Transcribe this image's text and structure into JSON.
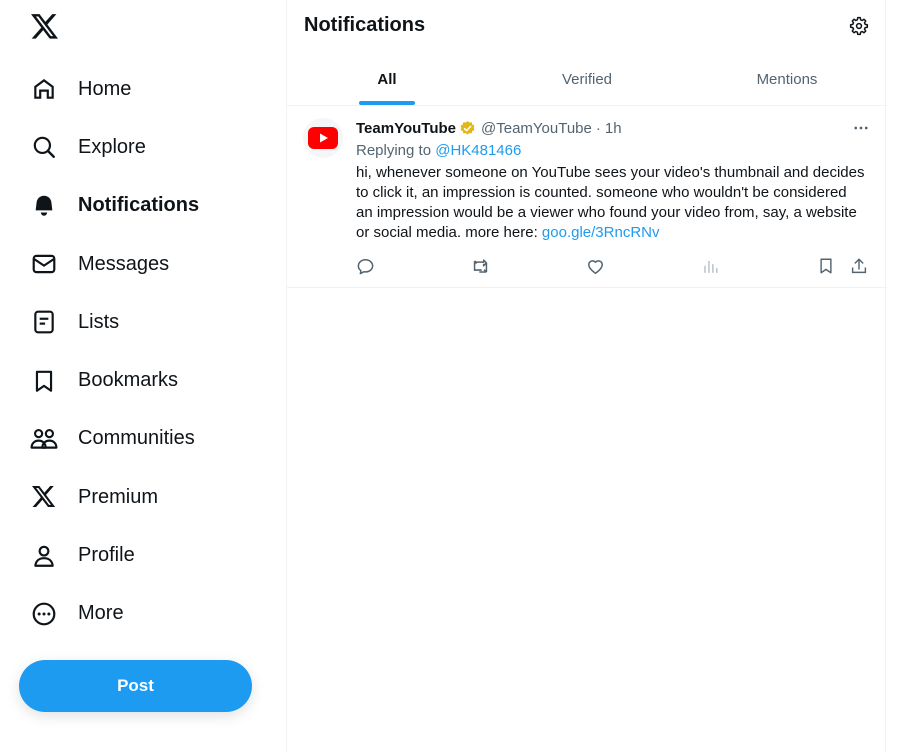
{
  "sidebar": {
    "logo": "x-logo-icon",
    "items": [
      {
        "label": "Home",
        "icon": "home-icon"
      },
      {
        "label": "Explore",
        "icon": "search-icon"
      },
      {
        "label": "Notifications",
        "icon": "bell-icon",
        "active": true
      },
      {
        "label": "Messages",
        "icon": "envelope-icon"
      },
      {
        "label": "Lists",
        "icon": "list-icon"
      },
      {
        "label": "Bookmarks",
        "icon": "bookmark-icon"
      },
      {
        "label": "Communities",
        "icon": "communities-icon"
      },
      {
        "label": "Premium",
        "icon": "x-icon"
      },
      {
        "label": "Profile",
        "icon": "person-icon"
      },
      {
        "label": "More",
        "icon": "more-circle-icon"
      }
    ],
    "post_label": "Post"
  },
  "header": {
    "title": "Notifications",
    "settings_icon": "gear-icon"
  },
  "tabs": [
    {
      "label": "All",
      "active": true
    },
    {
      "label": "Verified"
    },
    {
      "label": "Mentions"
    }
  ],
  "tweet": {
    "name": "TeamYouTube",
    "handle": "@TeamYouTube",
    "separator": "·",
    "time": "1h",
    "reply_prefix": "Replying to",
    "reply_to": "@HK481466",
    "text": "hi, whenever someone on YouTube sees your video's thumbnail and decides to click it, an impression is counted. someone who wouldn't be considered an impression would be a viewer who found your video from, say, a website or social media. more here: ",
    "link": "goo.gle/3RncRNv"
  },
  "colors": {
    "accent": "#1d9bf0",
    "text": "#0f1419",
    "secondary": "#536471",
    "verified_gold": "#e2b719",
    "youtube_red": "#ff0000"
  }
}
